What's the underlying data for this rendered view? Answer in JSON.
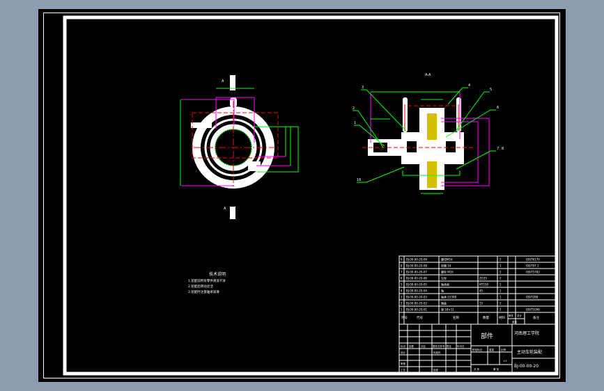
{
  "drawing": {
    "view_labels": {
      "section_a_top": "A",
      "section_a_bottom": "A",
      "side_view": "A-A"
    },
    "notes": {
      "title": "技术说明",
      "lines": [
        "1.装配前所有零件清洗干净",
        "2.装配后转动灵活",
        "3.装配时注意轴承润滑"
      ]
    },
    "part_balloons": [
      "1",
      "2",
      "3",
      "4",
      "5",
      "6",
      "7",
      "8",
      "16"
    ]
  },
  "bom": {
    "rows": [
      {
        "no": "9",
        "code": "BJ-00-00-20-09",
        "name": "螺母M16",
        "qty": "2",
        "material": "",
        "note": "GB/T6170"
      },
      {
        "no": "8",
        "code": "BJ-00-00-20-08",
        "name": "垫圈 16",
        "qty": "1",
        "material": "",
        "note": "GB/T97.1"
      },
      {
        "no": "7",
        "code": "BJ-00-00-20-07",
        "name": "螺栓 M16",
        "qty": "2",
        "material": "",
        "note": "GB/T5782"
      },
      {
        "no": "6",
        "code": "BJ-00-00-20-06",
        "name": "车轮",
        "qty": "2",
        "material": "ZG35",
        "note": ""
      },
      {
        "no": "5",
        "code": "BJ-00-00-20-05",
        "name": "轴承座",
        "qty": "2",
        "material": "HT150",
        "note": ""
      },
      {
        "no": "4",
        "code": "BJ-00-00-20-04",
        "name": "轴",
        "qty": "1",
        "material": "45",
        "note": ""
      },
      {
        "no": "3",
        "code": "BJ-00-00-20-03",
        "name": "轴承 22308",
        "qty": "1",
        "material": "",
        "note": "GB/T288"
      },
      {
        "no": "2",
        "code": "BJ-00-00-20-02",
        "name": "端盖",
        "qty": "2",
        "material": "15",
        "note": ""
      },
      {
        "no": "1",
        "code": "BJ-00-00-20-01",
        "name": "键 18×11",
        "qty": "1",
        "material": "",
        "note": "GB/T1096"
      }
    ],
    "headers": {
      "no": "序号",
      "code": "代号",
      "name": "名称",
      "qty": "数量",
      "material": "材料",
      "weight_single": "单件",
      "weight_total": "总计",
      "weight": "重量",
      "note": "备注"
    }
  },
  "title_block": {
    "label": "部件",
    "school": "河南理工学院",
    "drawing_name": "主动车轮装配",
    "drawing_no": "BJ-00-00-20",
    "labels": {
      "mark": "标记",
      "count": "处数",
      "zone": "分区",
      "change_doc": "更改文件号",
      "sign": "签名",
      "date": "年月日",
      "design": "设计",
      "standardize": "标准化",
      "stage_mark": "阶段标记",
      "weight": "重量",
      "scale": "比例",
      "review": "审核",
      "process": "工艺",
      "approve": "批准",
      "sheet_total": "共  张",
      "sheet": "第  张",
      "scale_value": "1:5"
    }
  },
  "colors": {
    "background": "#8e9cb1",
    "canvas": "#000000",
    "lines": "#ffffff",
    "dimension": "#00ff00",
    "center": "#ff0000",
    "hidden": "#ff00ff",
    "hatch": "#ffff00"
  }
}
